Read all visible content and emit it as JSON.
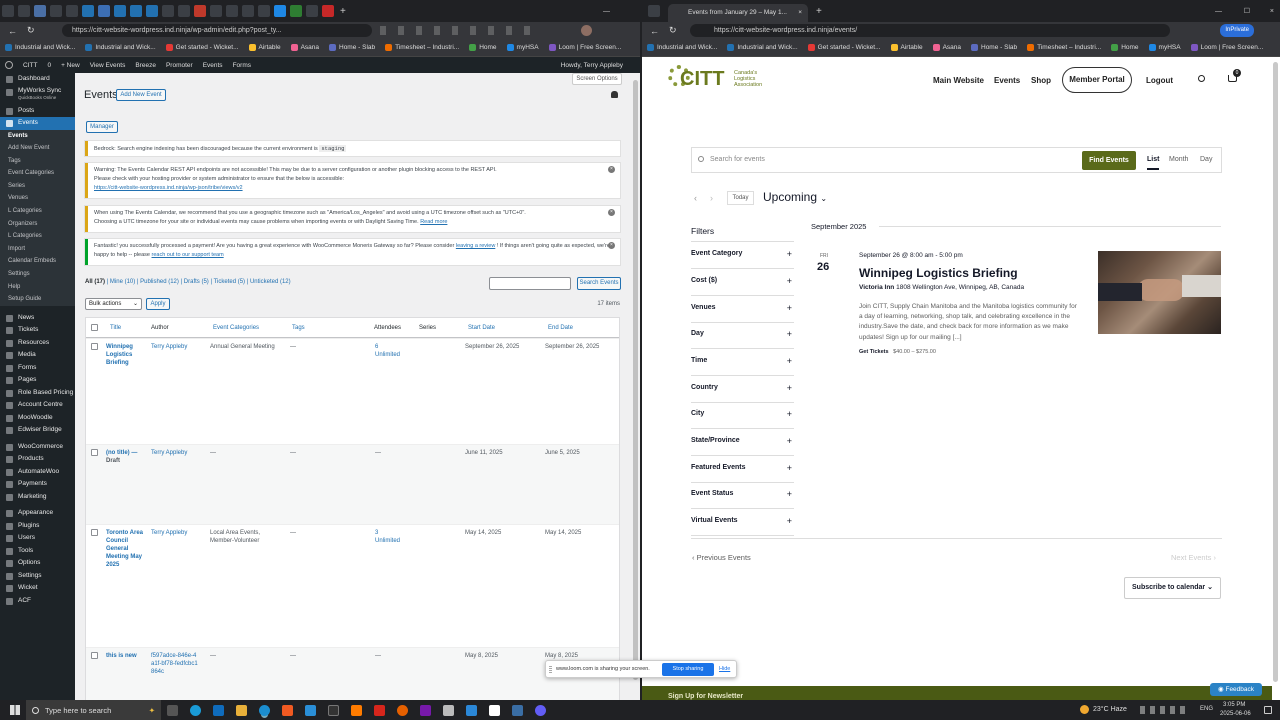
{
  "left_browser": {
    "url": "https://citt-website-wordpress.ind.ninja/wp-admin/edit.php?post_ty...",
    "favorites": [
      "Industrial and Wick...",
      "Industrial and Wick...",
      "Get started - Wicket...",
      "Airtable",
      "Asana",
      "Home - Slab",
      "Timesheet – Industri...",
      "Home",
      "myHSA",
      "Loom | Free Screen..."
    ],
    "adminbar": {
      "site": "CITT",
      "comments": "0",
      "new": "+ New",
      "view_events": "View Events",
      "breeze": "Breeze",
      "promoter": "Promoter",
      "events": "Events",
      "forms": "Forms",
      "howdy": "Howdy, Terry Appleby",
      "screen_options": "Screen Options"
    },
    "sidebar": {
      "dashboard": "Dashboard",
      "myworks": "MyWorks Sync",
      "myworks_sub": "QuickBooks Online",
      "posts": "Posts",
      "events": "Events",
      "events_sub": [
        "Events",
        "Add New Event",
        "Tags",
        "Event Categories",
        "Series",
        "Venues",
        "L Categories",
        "Organizers",
        "L Categories",
        "Import",
        "Calendar Embeds",
        "Settings",
        "Help",
        "Setup Guide"
      ],
      "items_after": [
        "News",
        "Tickets",
        "Resources",
        "Media",
        "Forms",
        "Pages",
        "Role Based Pricing",
        "Account Centre",
        "MooWoodle",
        "Edwiser Bridge",
        "WooCommerce",
        "Products",
        "AutomateWoo",
        "Payments",
        "Marketing",
        "Appearance",
        "Plugins",
        "Users",
        "Tools",
        "Options",
        "Settings",
        "Wicket",
        "ACF"
      ]
    },
    "page": {
      "title": "Events",
      "add_new": "Add New Event",
      "manager": "Manager",
      "notice_bedrock": "Bedrock: Search engine indexing has been discouraged because the current environment is",
      "notice_bedrock_code": "staging",
      "notice_warning_1": "Warning: The Events Calendar REST API endpoints are not accessible! This may be due to a server configuration or another plugin blocking access to the REST API.",
      "notice_warning_2": "Please check with your hosting provider or system administrator to ensure that the below is accessible:",
      "notice_warning_link": "https://citt-website-wordpress.ind.ninja/wp-json/tribe/views/v2",
      "notice_tz_1": "When using The Events Calendar, we recommend that you use a geographic timezone such as \"America/Los_Angeles\" and avoid using a UTC timezone offset such as \"UTC+0\".",
      "notice_tz_2": "Choosing a UTC timezone for your site or individual events may cause problems when importing events or with Daylight Saving Time.",
      "notice_tz_link": "Read more",
      "notice_pay_1": "Fantastic! you successfully processed a payment! Are you having a great experience with WooCommerce Moneris Gateway so far? Please consider",
      "notice_pay_link1": "leaving a review",
      "notice_pay_2": "! If things aren't going quite as expected, we're happy to help -- please",
      "notice_pay_link2": "reach out to our support team",
      "filters": [
        "All (17)",
        "Mine (10)",
        "Published (12)",
        "Drafts (5)",
        "Ticketed (5)",
        "Unticketed (12)"
      ],
      "search_button": "Search Events",
      "bulk_actions": "Bulk actions",
      "apply": "Apply",
      "items_count": "17 items",
      "columns": [
        "Title",
        "Author",
        "Event Categories",
        "Tags",
        "Attendees",
        "Series",
        "Start Date",
        "End Date"
      ],
      "rows": [
        {
          "title": "Winnipeg Logistics Briefing",
          "draft": "",
          "author": "Terry Appleby",
          "category": "Annual General Meeting",
          "tags": "—",
          "attendees": "6",
          "att2": "Unlimited",
          "series": "",
          "start": "September 26, 2025",
          "end": "September 26, 2025"
        },
        {
          "title": "(no title) —",
          "draft": "Draft",
          "author": "Terry Appleby",
          "category": "—",
          "tags": "—",
          "attendees": "—",
          "att2": "",
          "series": "",
          "start": "June 11, 2025",
          "end": "June 5, 2025"
        },
        {
          "title": "Toronto Area Council General Meeting May 2025",
          "draft": "",
          "author": "Terry Appleby",
          "category": "Local Area Events, Member-Volunteer",
          "tags": "—",
          "attendees": "3",
          "att2": "Unlimited",
          "series": "",
          "start": "May 14, 2025",
          "end": "May 14, 2025"
        },
        {
          "title": "this is new",
          "draft": "",
          "author": "f597adce-846e-4a1f-bf78-fedfcbc1864c",
          "category": "—",
          "tags": "—",
          "attendees": "—",
          "att2": "",
          "series": "",
          "start": "May 8, 2025",
          "end": "May 8, 2025"
        }
      ]
    }
  },
  "right_browser": {
    "tab_title": "Events from January 29 – May 1...",
    "url": "https://citt-website-wordpress.ind.ninja/events/",
    "inprivate": "InPrivate",
    "favorites": [
      "Industrial and Wick...",
      "Industrial and Wick...",
      "Get started - Wicket...",
      "Airtable",
      "Asana",
      "Home - Slab",
      "Timesheet – Industri...",
      "Home",
      "myHSA",
      "Loom | Free Screen..."
    ],
    "logo": {
      "abbr": "CITT",
      "line1": "Canada's",
      "line2": "Logistics",
      "line3": "Association"
    },
    "nav": [
      "Main Website",
      "Events",
      "Shop"
    ],
    "member_portal": "Member Portal",
    "logout": "Logout",
    "cart_count": "0",
    "search_placeholder": "Search for events",
    "find_events": "Find Events",
    "views": [
      "List",
      "Month",
      "Day"
    ],
    "today": "Today",
    "upcoming": "Upcoming",
    "filters_title": "Filters",
    "filters": [
      "Event Category",
      "Cost ($)",
      "Venues",
      "Day",
      "Time",
      "Country",
      "City",
      "State/Province",
      "Featured Events",
      "Event Status",
      "Virtual Events"
    ],
    "month_header": "September 2025",
    "event": {
      "dow": "FRI",
      "day": "26",
      "datetime": "September 26 @ 8:00 am - 5:00 pm",
      "title": "Winnipeg Logistics Briefing",
      "venue": "Victoria Inn",
      "address": "1808 Wellington Ave, Winnipeg, AB, Canada",
      "description": "Join CITT, Supply Chain Manitoba and the Manitoba logistics community for a day of learning, networking, shop talk, and celebrating excellence in the industry.Save the date, and check back for more information as we make updates! Sign up for our mailing [...]",
      "tickets_label": "Get Tickets",
      "price": "$40.00 – $275.00"
    },
    "previous_events": "Previous Events",
    "next_events": "Next Events",
    "subscribe": "Subscribe to calendar",
    "feedback": "Feedback",
    "newsletter_peek": "Sign Up for Newsletter"
  },
  "loom_bar": {
    "text": "www.loom.com is sharing your screen.",
    "stop": "Stop sharing",
    "hide": "Hide"
  },
  "taskbar": {
    "search": "Type here to search",
    "weather": "23°C  Haze",
    "lang": "ENG",
    "time": "3:05 PM",
    "date": "2025-06-06"
  },
  "colors": {
    "wp_blue": "#2271b1",
    "wp_dark": "#1d2327",
    "citt_olive": "#6b7a1e",
    "find_btn": "#5a6a1a"
  }
}
